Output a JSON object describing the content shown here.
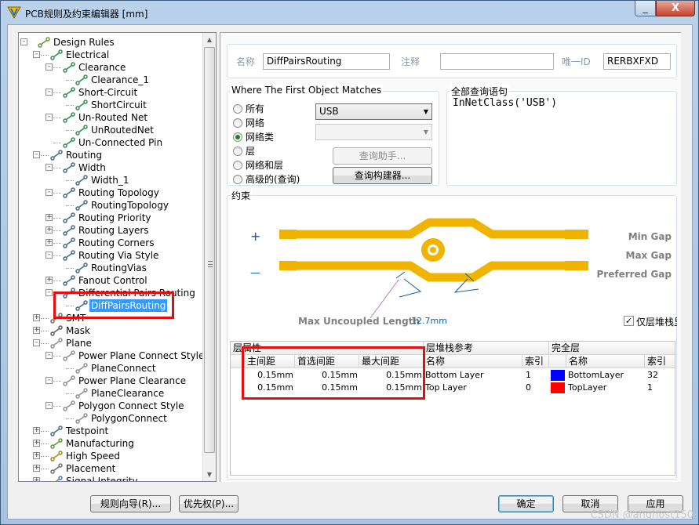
{
  "window": {
    "title": "PCB规则及约束编辑器 [mm]",
    "min_glyph": "_",
    "close_glyph": "X"
  },
  "tree": [
    {
      "label": "Design Rules",
      "depth": 0,
      "exp": "-",
      "icon": "design-rules-icon"
    },
    {
      "label": "Electrical",
      "depth": 1,
      "exp": "-",
      "icon": "electrical-icon"
    },
    {
      "label": "Clearance",
      "depth": 2,
      "exp": "-",
      "icon": "rule-icon"
    },
    {
      "label": "Clearance_1",
      "depth": 3,
      "exp": "",
      "icon": "rule-icon"
    },
    {
      "label": "Short-Circuit",
      "depth": 2,
      "exp": "-",
      "icon": "rule-icon"
    },
    {
      "label": "ShortCircuit",
      "depth": 3,
      "exp": "",
      "icon": "rule-icon"
    },
    {
      "label": "Un-Routed Net",
      "depth": 2,
      "exp": "-",
      "icon": "rule-icon"
    },
    {
      "label": "UnRoutedNet",
      "depth": 3,
      "exp": "",
      "icon": "rule-icon"
    },
    {
      "label": "Un-Connected Pin",
      "depth": 2,
      "exp": "",
      "icon": "rule-icon"
    },
    {
      "label": "Routing",
      "depth": 1,
      "exp": "-",
      "icon": "routing-icon"
    },
    {
      "label": "Width",
      "depth": 2,
      "exp": "-",
      "icon": "routing-icon"
    },
    {
      "label": "Width_1",
      "depth": 3,
      "exp": "",
      "icon": "routing-icon"
    },
    {
      "label": "Routing Topology",
      "depth": 2,
      "exp": "-",
      "icon": "routing-icon"
    },
    {
      "label": "RoutingTopology",
      "depth": 3,
      "exp": "",
      "icon": "routing-icon"
    },
    {
      "label": "Routing Priority",
      "depth": 2,
      "exp": "+",
      "icon": "routing-icon"
    },
    {
      "label": "Routing Layers",
      "depth": 2,
      "exp": "+",
      "icon": "routing-icon"
    },
    {
      "label": "Routing Corners",
      "depth": 2,
      "exp": "+",
      "icon": "routing-icon"
    },
    {
      "label": "Routing Via Style",
      "depth": 2,
      "exp": "-",
      "icon": "routing-icon"
    },
    {
      "label": "RoutingVias",
      "depth": 3,
      "exp": "",
      "icon": "routing-icon"
    },
    {
      "label": "Fanout Control",
      "depth": 2,
      "exp": "+",
      "icon": "routing-icon"
    },
    {
      "label": "Differential Pairs Routing",
      "depth": 2,
      "exp": "-",
      "icon": "routing-icon"
    },
    {
      "label": "DiffPairsRouting",
      "depth": 3,
      "exp": "",
      "icon": "routing-icon",
      "selected": true
    },
    {
      "label": "SMT",
      "depth": 1,
      "exp": "+",
      "icon": "smt-icon"
    },
    {
      "label": "Mask",
      "depth": 1,
      "exp": "+",
      "icon": "mask-icon"
    },
    {
      "label": "Plane",
      "depth": 1,
      "exp": "-",
      "icon": "plane-icon"
    },
    {
      "label": "Power Plane Connect Style",
      "depth": 2,
      "exp": "-",
      "icon": "plane-icon"
    },
    {
      "label": "PlaneConnect",
      "depth": 3,
      "exp": "",
      "icon": "plane-icon"
    },
    {
      "label": "Power Plane Clearance",
      "depth": 2,
      "exp": "-",
      "icon": "plane-icon"
    },
    {
      "label": "PlaneClearance",
      "depth": 3,
      "exp": "",
      "icon": "plane-icon"
    },
    {
      "label": "Polygon Connect Style",
      "depth": 2,
      "exp": "-",
      "icon": "plane-icon"
    },
    {
      "label": "PolygonConnect",
      "depth": 3,
      "exp": "",
      "icon": "plane-icon"
    },
    {
      "label": "Testpoint",
      "depth": 1,
      "exp": "+",
      "icon": "testpoint-icon"
    },
    {
      "label": "Manufacturing",
      "depth": 1,
      "exp": "+",
      "icon": "manufacturing-icon"
    },
    {
      "label": "High Speed",
      "depth": 1,
      "exp": "+",
      "icon": "highspeed-icon"
    },
    {
      "label": "Placement",
      "depth": 1,
      "exp": "+",
      "icon": "placement-icon"
    },
    {
      "label": "Signal Integrity",
      "depth": 1,
      "exp": "+",
      "icon": "signal-icon"
    }
  ],
  "rule": {
    "name_label": "名称",
    "name_value": "DiffPairsRouting",
    "comment_label": "注释",
    "comment_value": "",
    "id_label": "唯一ID",
    "id_value": "RERBXFXD"
  },
  "match": {
    "title": "Where The First Object Matches",
    "options": [
      "所有",
      "网络",
      "网络类",
      "层",
      "网络和层",
      "高级的(查询)"
    ],
    "selected_index": 2,
    "combo1": "USB",
    "combo2": "",
    "helper_btn": "查询助手...",
    "builder_btn": "查询构建器..."
  },
  "query": {
    "title": "全部查询语句",
    "text": "InNetClass('USB')"
  },
  "constraints": {
    "title": "约束",
    "plus": "+",
    "minus": "—",
    "min_gap": "Min Gap",
    "max_gap": "Max Gap",
    "pref_gap": "Preferred Gap",
    "max_uncoupled_label": "Max Uncoupled Length",
    "max_uncoupled_value": "12.7mm",
    "stack_only_label": "仅层堆栈里",
    "stack_only_checked": true
  },
  "grid": {
    "layer_props": "层属性",
    "stack_ref": "层堆栈参考",
    "full_layers": "完全层",
    "cols_left": [
      "主间距",
      "首选间距",
      "最大间距"
    ],
    "col_name": "名称",
    "col_sort": "/",
    "col_index": "索引",
    "col_name2": "名称",
    "col_index2": "索引",
    "rows": [
      {
        "min": "0.15mm",
        "pref": "0.15mm",
        "max": "0.15mm",
        "layer": "Bottom Layer",
        "idx": "1",
        "full": "BottomLayer",
        "full_idx": "32",
        "color": "#0000ff"
      },
      {
        "min": "0.15mm",
        "pref": "0.15mm",
        "max": "0.15mm",
        "layer": "Top Layer",
        "idx": "0",
        "full": "TopLayer",
        "full_idx": "1",
        "color": "#ff0000"
      }
    ]
  },
  "buttons": {
    "wizard": "规则向导(R)...",
    "priority": "优先权(P)...",
    "ok": "确定",
    "cancel": "取消",
    "apply": "应用"
  },
  "watermark": "CSDN @anghost150",
  "colors": {
    "trace": "#f0b400",
    "annot": "#1060a0",
    "highlight": "#e01010",
    "select": "#3399ff"
  }
}
